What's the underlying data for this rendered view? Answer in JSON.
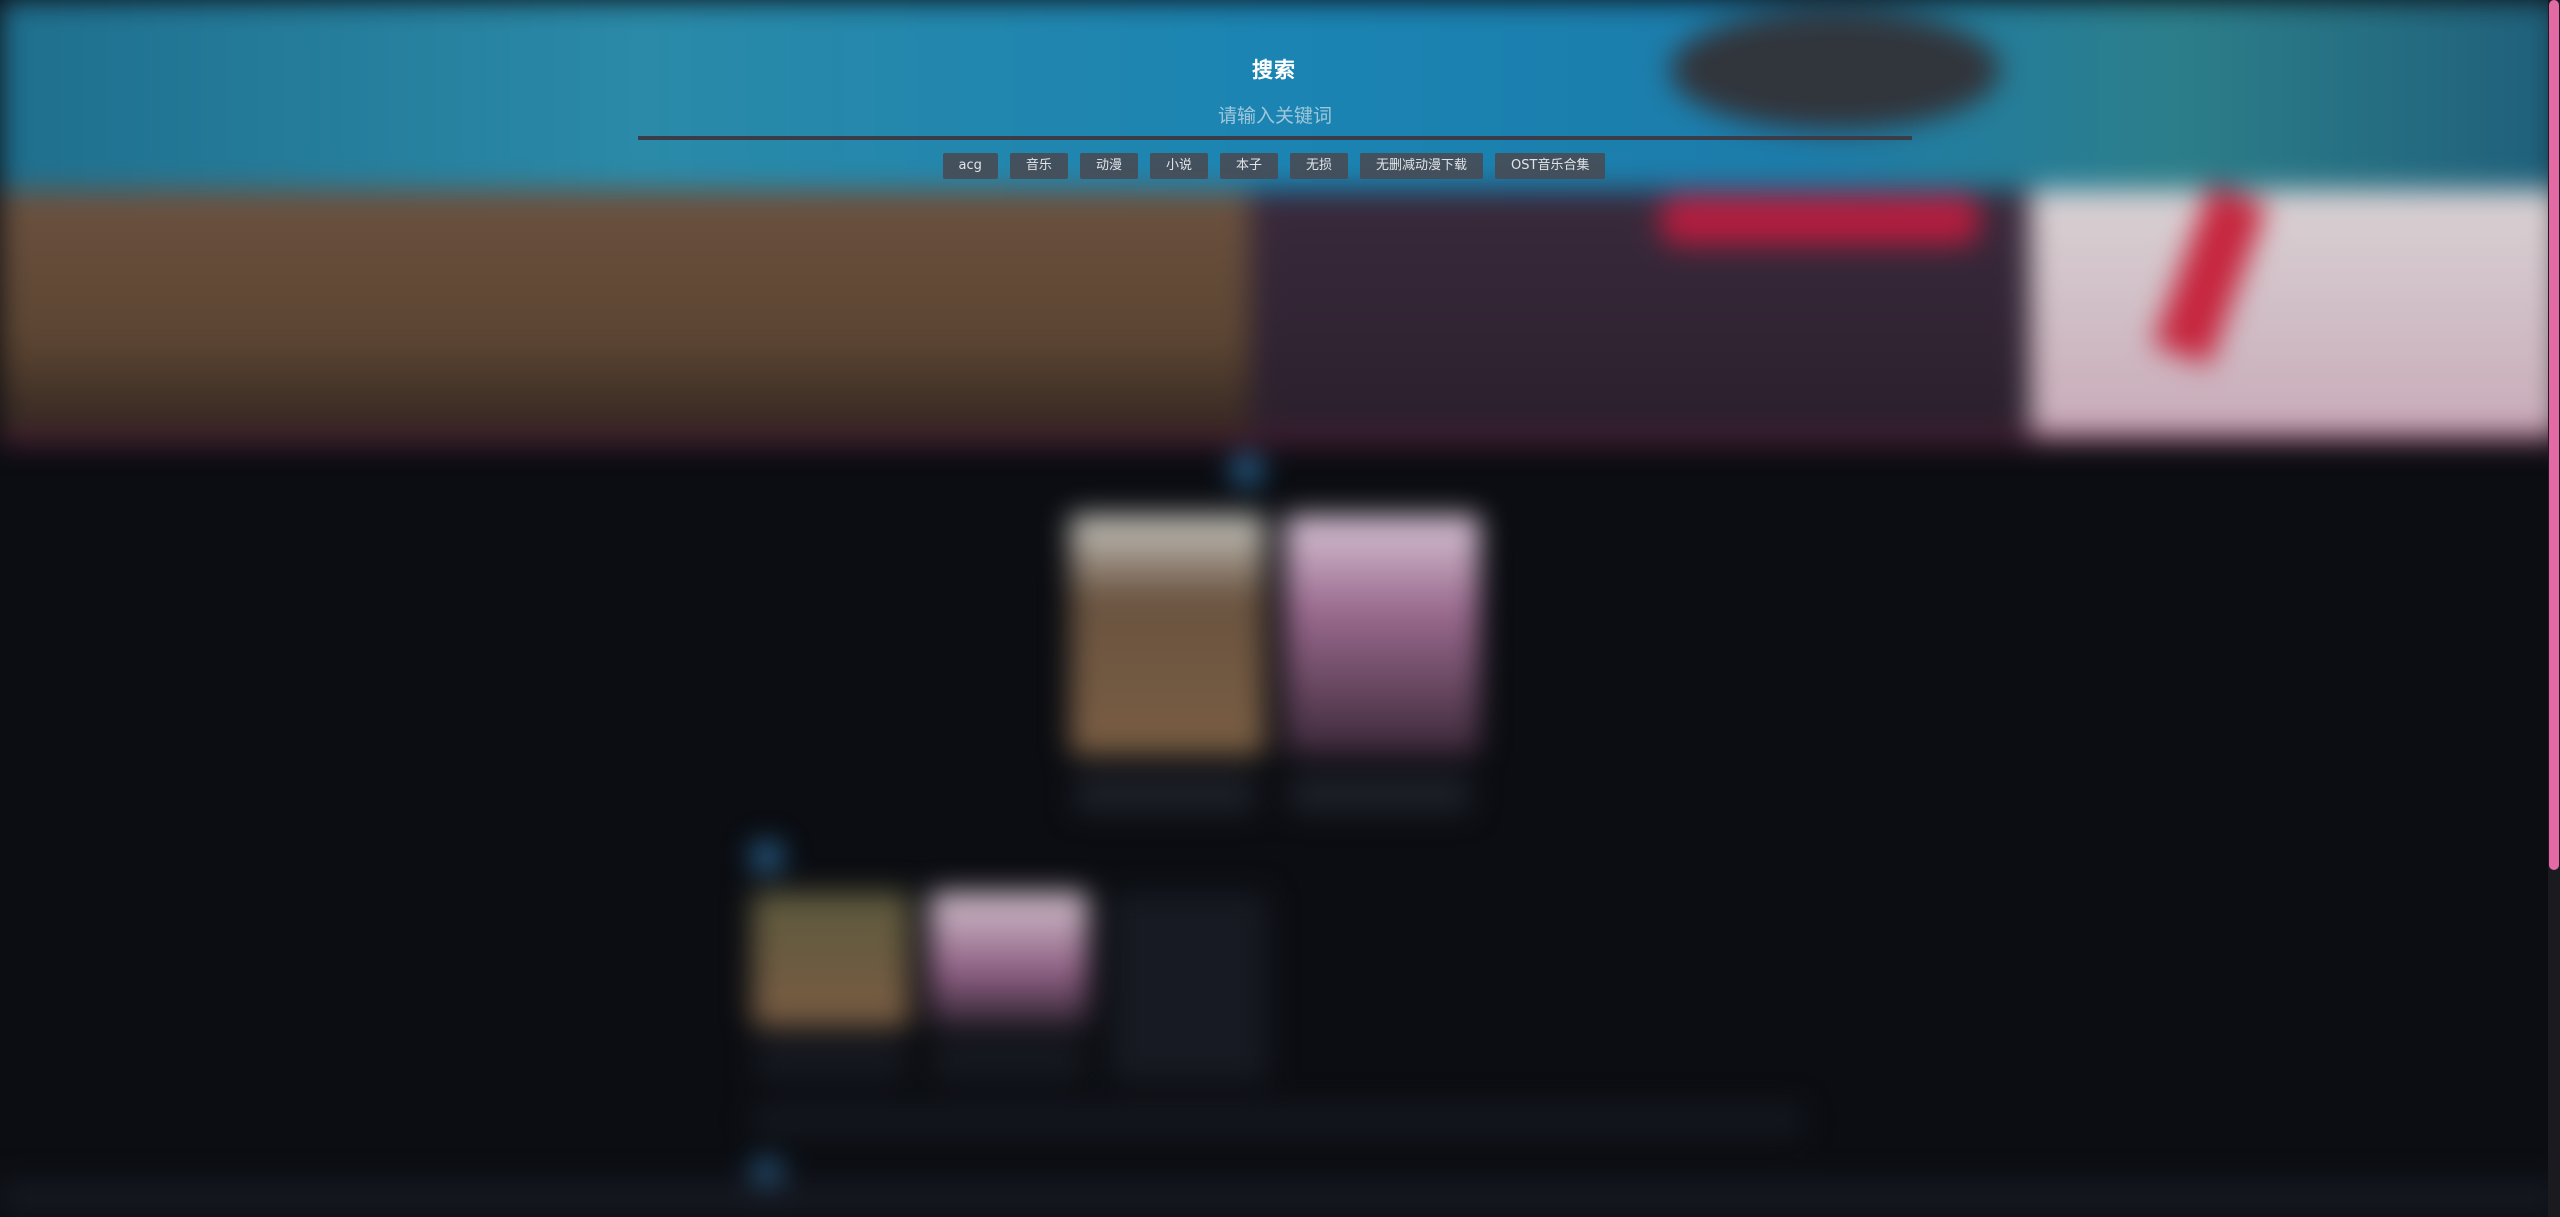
{
  "search": {
    "title": "搜索",
    "placeholder": "请输入关键词",
    "value": ""
  },
  "tags": [
    {
      "label": "acg"
    },
    {
      "label": "音乐"
    },
    {
      "label": "动漫"
    },
    {
      "label": "小说"
    },
    {
      "label": "本子"
    },
    {
      "label": "无损"
    },
    {
      "label": "无删减动漫下载"
    },
    {
      "label": "OST音乐合集"
    }
  ],
  "colors": {
    "accent_scrollbar": "#e46aa6",
    "tag_background": "#464c56",
    "page_background": "#0b0d12"
  }
}
